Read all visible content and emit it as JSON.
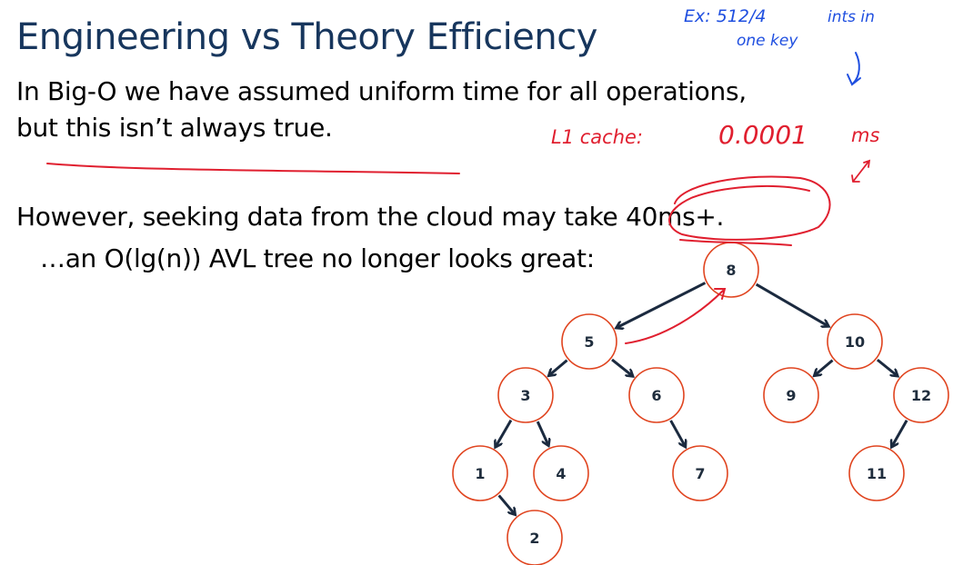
{
  "slide": {
    "title": "Engineering vs Theory Efficiency",
    "lines": [
      "In Big-O we have assumed uniform time for all operations,",
      "but this isn’t always true.",
      "However, seeking data from the cloud may take 40ms+.",
      "…an O(lg(n)) AVL tree no longer looks great:"
    ]
  },
  "annotations": {
    "blue_line1": "Ex: 512/4",
    "blue_line1b": "ints in",
    "blue_line2": "one key",
    "red_cache": "L1 cache:",
    "red_value": "0.0001",
    "red_unit": "ms"
  },
  "colors": {
    "title": "#17365d",
    "node_stroke": "#e0441f",
    "edge": "#1b2a3f",
    "ink_blue": "#1f4fe0",
    "ink_red": "#e01f2f"
  },
  "tree": {
    "nodes": [
      {
        "id": "n8",
        "label": "8"
      },
      {
        "id": "n5",
        "label": "5"
      },
      {
        "id": "n10",
        "label": "10"
      },
      {
        "id": "n3",
        "label": "3"
      },
      {
        "id": "n6",
        "label": "6"
      },
      {
        "id": "n9",
        "label": "9"
      },
      {
        "id": "n12",
        "label": "12"
      },
      {
        "id": "n1",
        "label": "1"
      },
      {
        "id": "n4",
        "label": "4"
      },
      {
        "id": "n7",
        "label": "7"
      },
      {
        "id": "n11",
        "label": "11"
      },
      {
        "id": "n2",
        "label": "2"
      }
    ],
    "edges": [
      {
        "from": "n8",
        "to": "n5"
      },
      {
        "from": "n8",
        "to": "n10"
      },
      {
        "from": "n5",
        "to": "n3"
      },
      {
        "from": "n5",
        "to": "n6"
      },
      {
        "from": "n10",
        "to": "n9"
      },
      {
        "from": "n10",
        "to": "n12"
      },
      {
        "from": "n3",
        "to": "n1"
      },
      {
        "from": "n3",
        "to": "n4"
      },
      {
        "from": "n6",
        "to": "n7"
      },
      {
        "from": "n12",
        "to": "n11"
      },
      {
        "from": "n1",
        "to": "n2"
      }
    ]
  }
}
